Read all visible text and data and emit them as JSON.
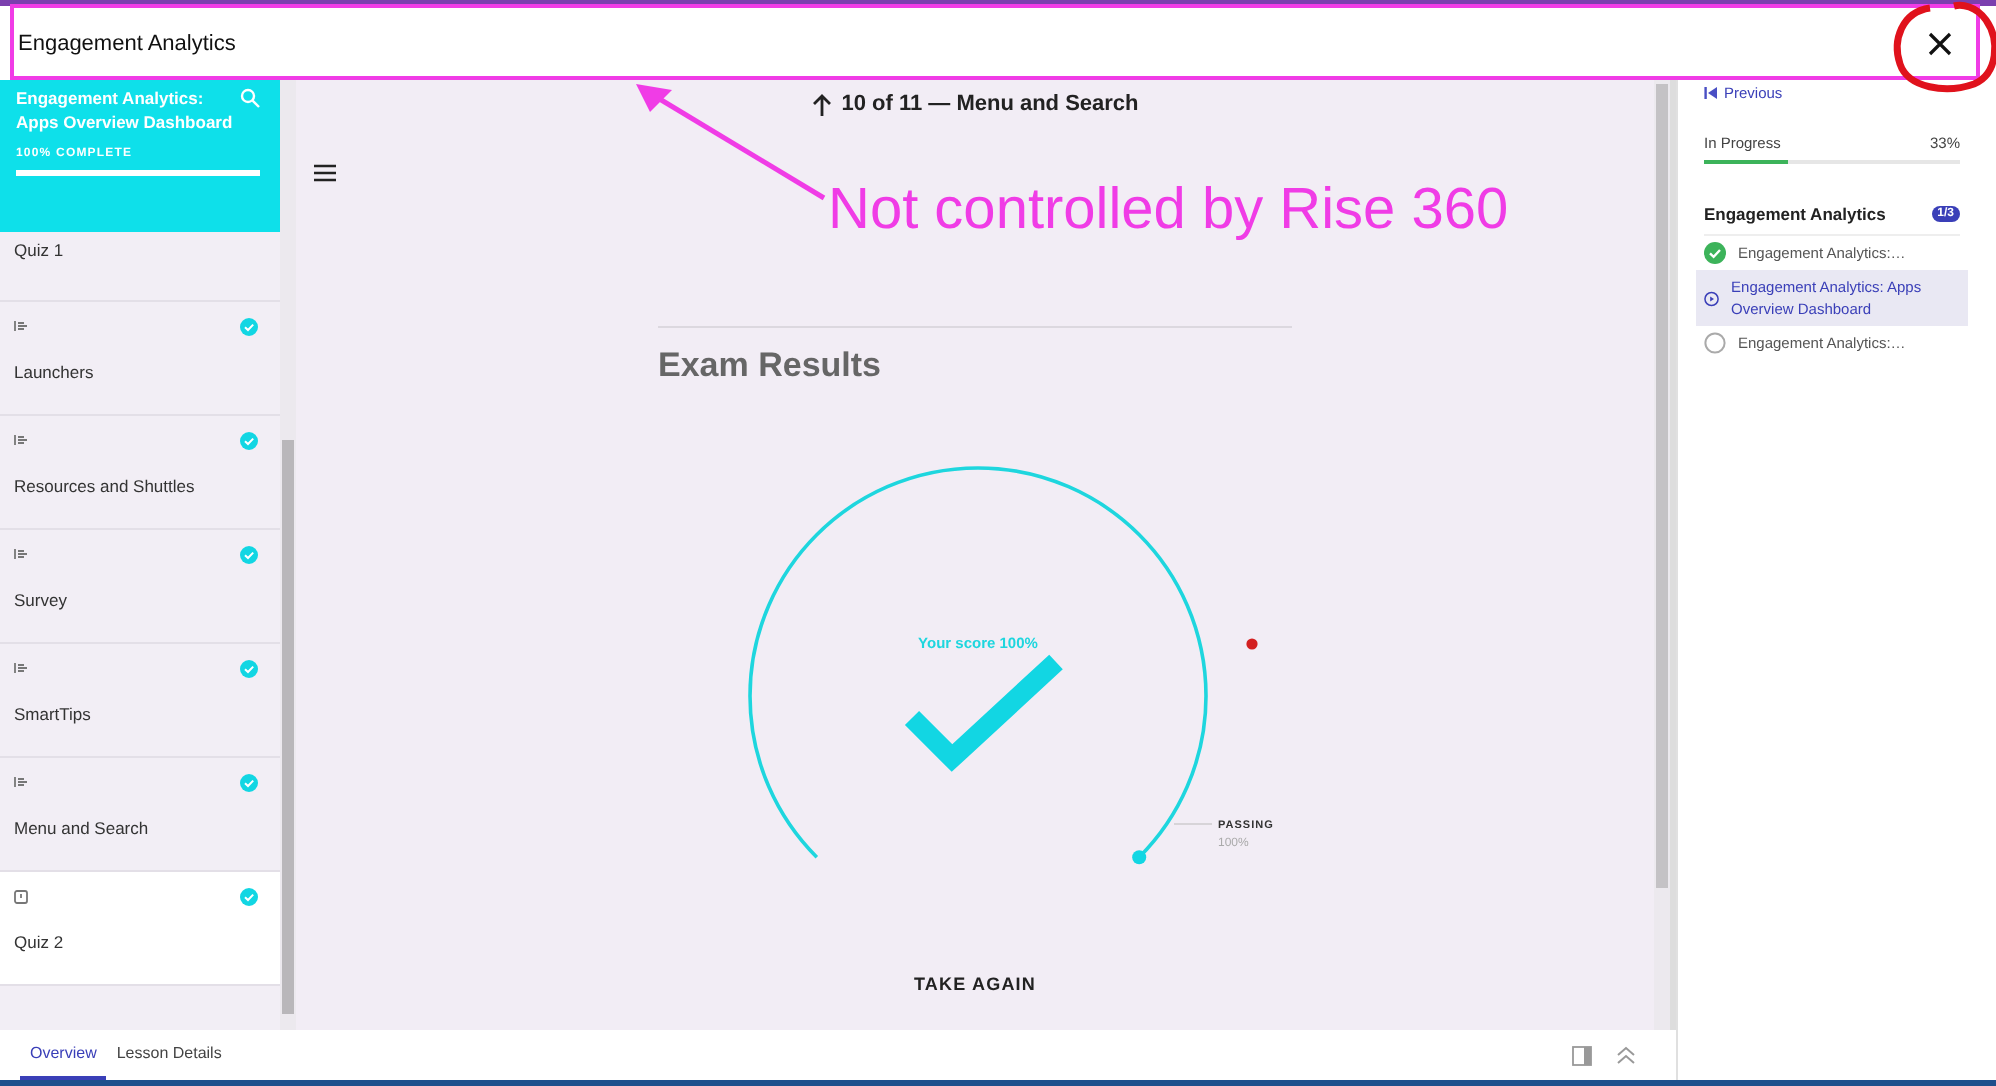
{
  "window": {
    "title": "Engagement Analytics"
  },
  "sidebar": {
    "title": "Engagement Analytics: Apps Overview Dashboard",
    "progress_label": "100% COMPLETE",
    "level": 1,
    "items": [
      {
        "label": "Quiz 1",
        "kind": "cut",
        "selected": false
      },
      {
        "label": "Launchers",
        "kind": "lesson",
        "completed": true,
        "selected": false
      },
      {
        "label": "Resources and Shuttles",
        "kind": "lesson",
        "completed": true,
        "selected": false
      },
      {
        "label": "Survey",
        "kind": "lesson",
        "completed": true,
        "selected": false
      },
      {
        "label": "SmartTips",
        "kind": "lesson",
        "completed": true,
        "selected": false
      },
      {
        "label": "Menu and Search",
        "kind": "lesson",
        "completed": true,
        "selected": false
      },
      {
        "label": "Quiz 2",
        "kind": "quiz",
        "completed": true,
        "selected": true
      }
    ]
  },
  "lesson": {
    "position": "10 of 11 — Menu and Search",
    "heading": "Exam Results",
    "gauge": {
      "label": "Your score 100%",
      "passing_label": "PASSING",
      "passing_value": "100%"
    },
    "action": "TAKE AGAIN"
  },
  "outline": {
    "previous": "Previous",
    "status": "In Progress",
    "percent": "33%",
    "level": 0.33,
    "section": "Engagement Analytics",
    "badge": "1/3",
    "items": [
      {
        "label": "Engagement Analytics:…",
        "kind": "done",
        "selected": false
      },
      {
        "label": "Engagement Analytics: Apps Overview Dashboard",
        "kind": "current",
        "selected": true
      },
      {
        "label": "Engagement Analytics:…",
        "kind": "todo",
        "selected": false
      }
    ]
  },
  "bottom_tabs": [
    {
      "label": "Overview",
      "selected": true
    },
    {
      "label": "Lesson Details",
      "selected": false
    }
  ],
  "annotation": {
    "text": "Not controlled by Rise 360"
  }
}
